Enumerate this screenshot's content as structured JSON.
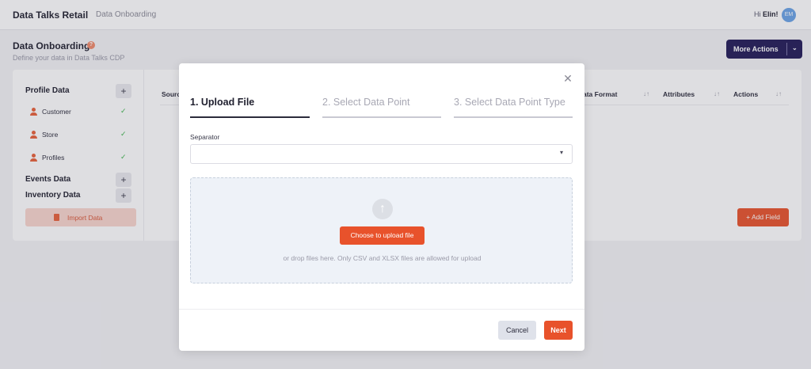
{
  "header": {
    "brand": "Data Talks Retail",
    "breadcrumb": "Data Onboarding",
    "greeting_prefix": "Hi ",
    "user_name": "Elin!",
    "avatar_initials": "EM"
  },
  "page": {
    "title": "Data Onboarding",
    "help_icon": "?",
    "subtitle": "Define your data in Data Talks CDP",
    "more_actions_label": "More Actions"
  },
  "sidebar": {
    "profile_title": "Profile Data",
    "profile_items": [
      {
        "label": "Customer",
        "icon": "user-icon",
        "status": "check"
      },
      {
        "label": "Store",
        "icon": "user-icon",
        "status": "check"
      },
      {
        "label": "Profiles",
        "icon": "user-icon",
        "status": "check"
      }
    ],
    "events_title": "Events Data",
    "inventory_title": "Inventory Data",
    "plus": "+",
    "check_glyph": "✓",
    "import_label": "Import Data"
  },
  "table": {
    "headers": [
      "Sourc",
      "ata Format",
      "Attributes",
      "Actions"
    ],
    "sort_glyph": "↓↑",
    "add_field_label": "+ Add Field"
  },
  "modal": {
    "close_glyph": "✕",
    "steps": [
      {
        "label": "1. Upload File",
        "active": true
      },
      {
        "label": "2. Select Data Point",
        "active": false
      },
      {
        "label": "3. Select Data Point Type",
        "active": false
      }
    ],
    "separator_label": "Separator",
    "separator_value": "",
    "choose_label": "Choose to upload file",
    "drop_hint": "or drop files here. Only CSV and XLSX files are allowed for upload",
    "cancel_label": "Cancel",
    "next_label": "Next"
  },
  "colors": {
    "accent": "#e8522b",
    "navy": "#211a57",
    "success": "#3bb34a"
  }
}
